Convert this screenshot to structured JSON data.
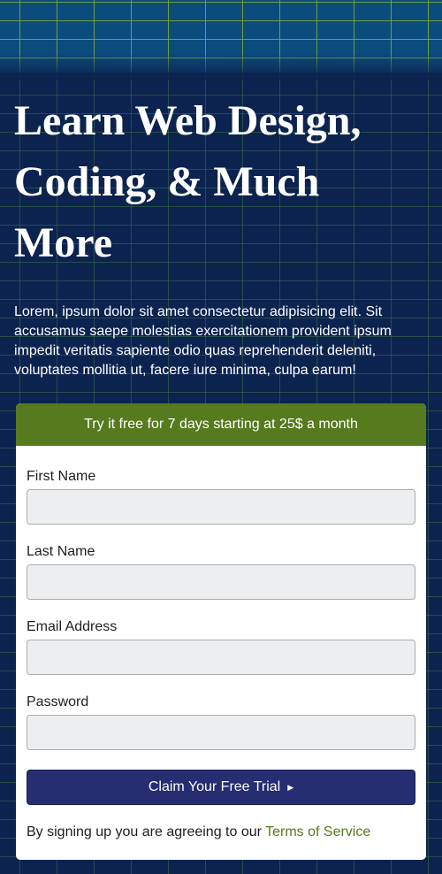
{
  "hero": {
    "title": "Learn Web Design, Coding, & Much More",
    "text": "Lorem, ipsum dolor sit amet consectetur adipisicing elit. Sit accusamus saepe molestias exercitationem provident ipsum impedit veritatis sapiente odio quas reprehenderit deleniti, voluptates mollitia ut, facere iure minima, culpa earum!"
  },
  "signup": {
    "header": "Try it free for 7 days starting at 25$ a month",
    "fields": [
      {
        "label": "First Name",
        "value": ""
      },
      {
        "label": "Last Name",
        "value": ""
      },
      {
        "label": "Email Address",
        "value": ""
      },
      {
        "label": "Password",
        "value": ""
      }
    ],
    "submit_label": "Claim Your Free Trial",
    "submit_icon": "play-triangle-icon",
    "terms_text": "By signing up you are agreeing to our",
    "terms_link": "Terms of Service"
  },
  "colors": {
    "background": "#0c2350",
    "accent_green": "#567a1e",
    "button": "#262d70"
  }
}
